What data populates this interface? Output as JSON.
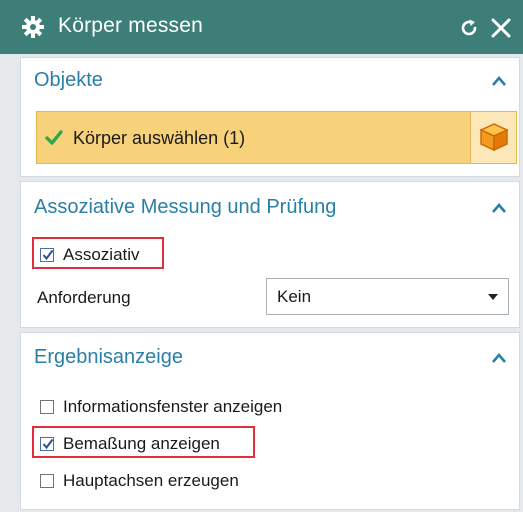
{
  "dialog": {
    "title": "Körper messen",
    "icons": {
      "settings": "gear-icon",
      "reset": "reset-icon",
      "close": "close-icon"
    }
  },
  "sections": {
    "objects": {
      "title": "Objekte",
      "select_label": "Körper auswählen (1)",
      "select_button_icon": "cube-icon"
    },
    "associative": {
      "title": "Assoziative Messung und Prüfung",
      "checkbox_label": "Assoziativ",
      "checkbox_checked": true,
      "requirement_label": "Anforderung",
      "requirement_value": "Kein"
    },
    "results": {
      "title": "Ergebnisanzeige",
      "options": [
        {
          "label": "Informationsfenster anzeigen",
          "checked": false
        },
        {
          "label": "Bemaßung anzeigen",
          "checked": true
        },
        {
          "label": "Hauptachsen erzeugen",
          "checked": false
        }
      ]
    }
  },
  "colors": {
    "titlebar": "#3d7f78",
    "section_title": "#2a7fa6",
    "selection_bar": "#f7d27a",
    "highlight": "#e22e3a",
    "check": "#2fa84f"
  }
}
